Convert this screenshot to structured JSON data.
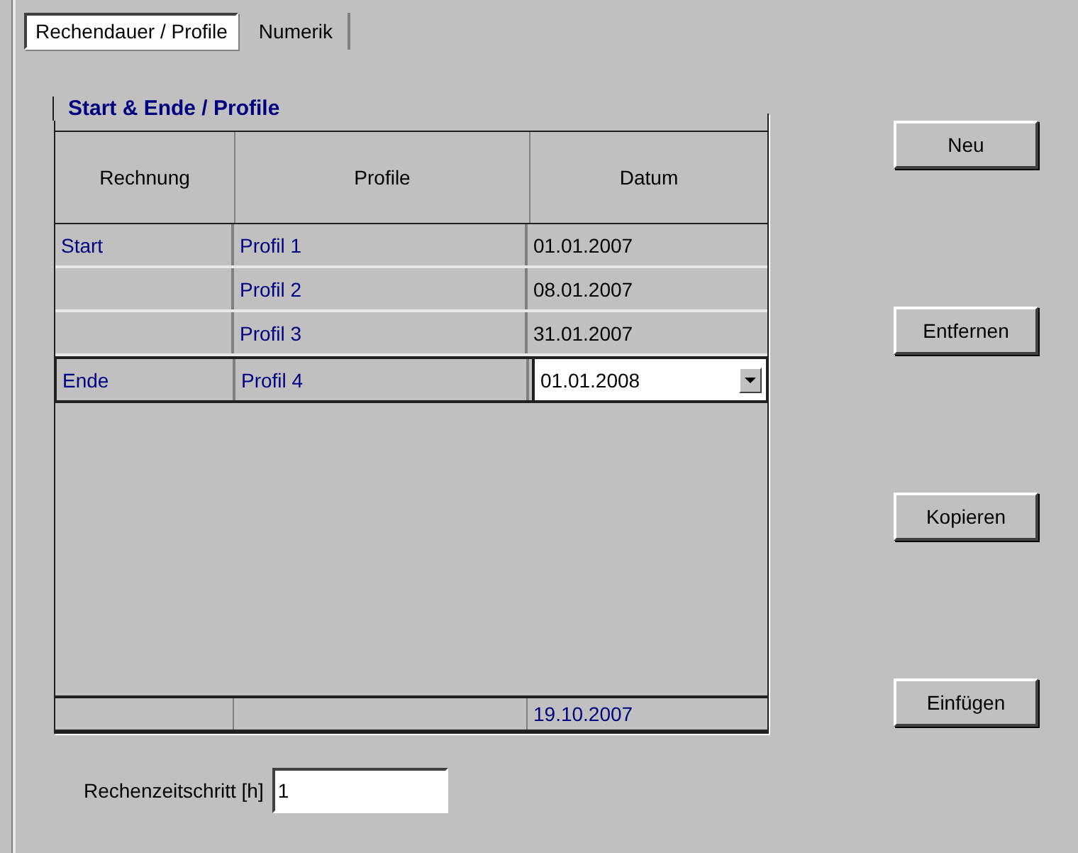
{
  "tabs": [
    {
      "label": "Rechendauer / Profile",
      "selected": true
    },
    {
      "label": "Numerik",
      "selected": false
    }
  ],
  "group": {
    "title": "Start & Ende / Profile",
    "table": {
      "columns": [
        "Rechnung",
        "Profile",
        "Datum"
      ],
      "rows": [
        {
          "rechnung": "Start",
          "profile": "Profil 1",
          "datum": "01.01.2007",
          "selected": false,
          "editing": false
        },
        {
          "profile": "Profil 2",
          "datum": "08.01.2007",
          "selected": false,
          "editing": false
        },
        {
          "profile": "Profil 3",
          "datum": "31.01.2007",
          "selected": false,
          "editing": false
        },
        {
          "rechnung": "Ende",
          "profile": "Profil 4",
          "datum": "01.01.2008",
          "selected": true,
          "editing": true
        }
      ],
      "footer": {
        "datum": "19.10.2007"
      }
    }
  },
  "buttons": [
    {
      "label": "Neu"
    },
    {
      "label": "Entfernen"
    },
    {
      "label": "Kopieren"
    },
    {
      "label": "Einfügen"
    }
  ],
  "step": {
    "label": "Rechenzeitschritt [h]",
    "value": "1"
  }
}
